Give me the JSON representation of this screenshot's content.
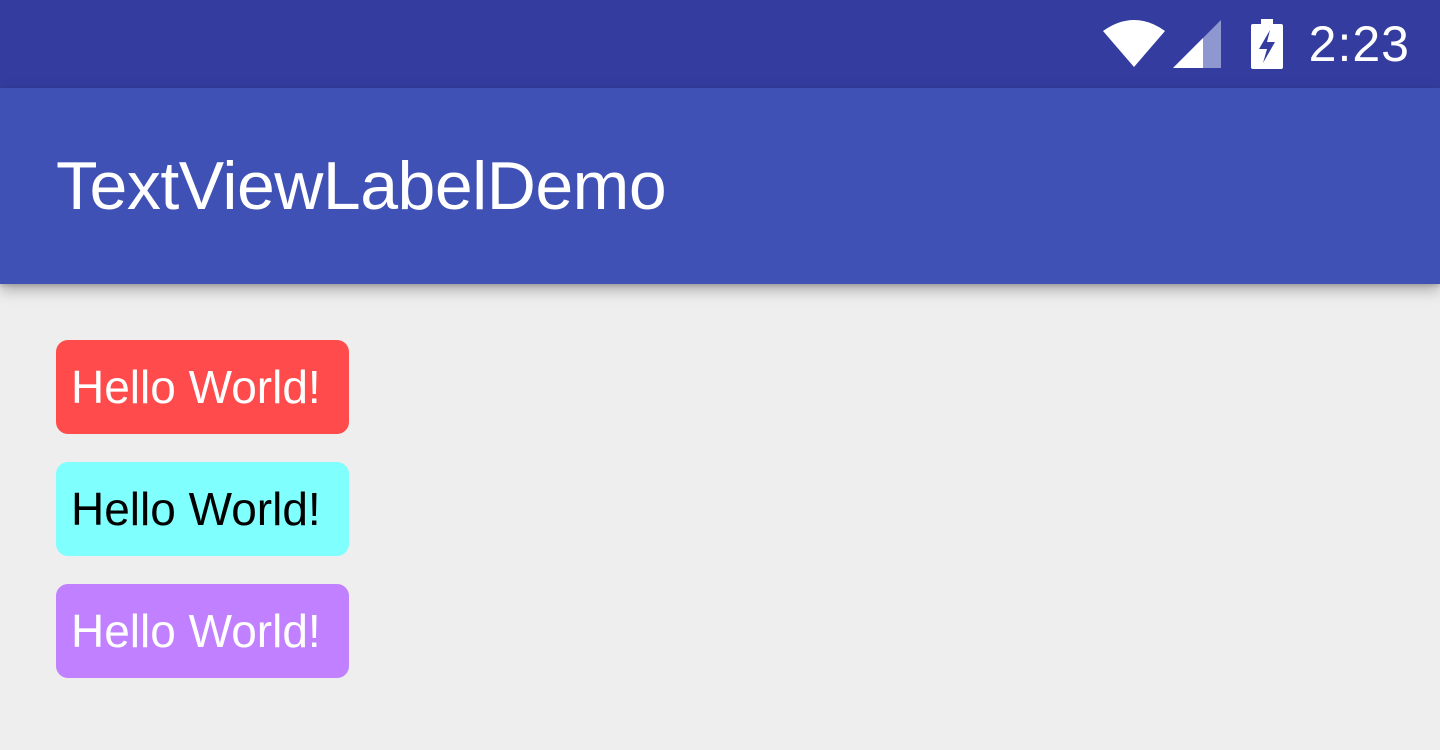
{
  "status_bar": {
    "time": "2:23",
    "icons": [
      "wifi-icon",
      "cell-signal-icon",
      "battery-charging-icon"
    ],
    "color": "#343d9f"
  },
  "app_bar": {
    "title": "TextViewLabelDemo",
    "color": "#4051b5"
  },
  "labels": [
    {
      "text": "Hello World!",
      "background": "#ff4b4b",
      "text_color": "#ffffff"
    },
    {
      "text": "Hello World!",
      "background": "#80ffff",
      "text_color": "#000000"
    },
    {
      "text": "Hello World!",
      "background": "#c080ff",
      "text_color": "#ffffff"
    }
  ],
  "background_color": "#eeeeee"
}
